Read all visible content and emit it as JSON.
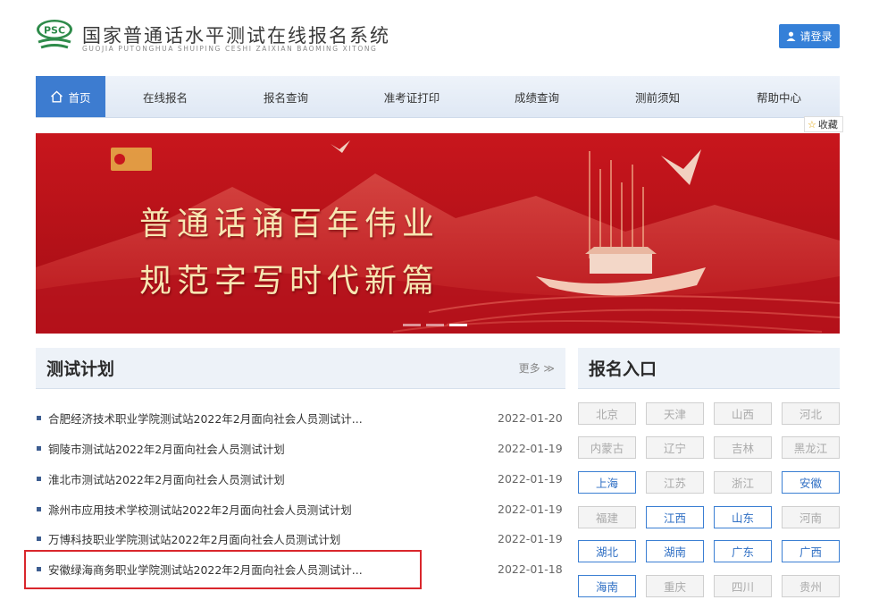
{
  "header": {
    "logo_text": "PSC",
    "title": "国家普通话水平测试在线报名系统",
    "subtitle": "GUOJIA PUTONGHUA SHUIPING CESHI ZAIXIAN BAOMING XITONG",
    "login_label": "请登录"
  },
  "nav": {
    "items": [
      "首页",
      "在线报名",
      "报名查询",
      "准考证打印",
      "成绩查询",
      "测前须知",
      "帮助中心"
    ],
    "favorite_label": "收藏"
  },
  "banner": {
    "line1": "普通话诵百年伟业",
    "line2": "规范字写时代新篇",
    "slides_total": 3,
    "slide_active": 3
  },
  "plan": {
    "title": "测试计划",
    "more_label": "更多 ≫",
    "rows": [
      {
        "text": "合肥经济技术职业学院测试站2022年2月面向社会人员测试计...",
        "date": "2022-01-20"
      },
      {
        "text": "铜陵市测试站2022年2月面向社会人员测试计划",
        "date": "2022-01-19"
      },
      {
        "text": "淮北市测试站2022年2月面向社会人员测试计划",
        "date": "2022-01-19"
      },
      {
        "text": "滁州市应用技术学校测试站2022年2月面向社会人员测试计划",
        "date": "2022-01-19"
      },
      {
        "text": "万博科技职业学院测试站2022年2月面向社会人员测试计划",
        "date": "2022-01-19"
      },
      {
        "text": "安徽绿海商务职业学院测试站2022年2月面向社会人员测试计...",
        "date": "2022-01-18"
      }
    ]
  },
  "signup": {
    "title": "报名入口",
    "regions": [
      {
        "name": "北京",
        "enabled": false
      },
      {
        "name": "天津",
        "enabled": false
      },
      {
        "name": "山西",
        "enabled": false
      },
      {
        "name": "河北",
        "enabled": false
      },
      {
        "name": "内蒙古",
        "enabled": false
      },
      {
        "name": "辽宁",
        "enabled": false
      },
      {
        "name": "吉林",
        "enabled": false
      },
      {
        "name": "黑龙江",
        "enabled": false
      },
      {
        "name": "上海",
        "enabled": true
      },
      {
        "name": "江苏",
        "enabled": false
      },
      {
        "name": "浙江",
        "enabled": false
      },
      {
        "name": "安徽",
        "enabled": true
      },
      {
        "name": "福建",
        "enabled": false
      },
      {
        "name": "江西",
        "enabled": true
      },
      {
        "name": "山东",
        "enabled": true
      },
      {
        "name": "河南",
        "enabled": false
      },
      {
        "name": "湖北",
        "enabled": true
      },
      {
        "name": "湖南",
        "enabled": true
      },
      {
        "name": "广东",
        "enabled": true
      },
      {
        "name": "广西",
        "enabled": true
      },
      {
        "name": "海南",
        "enabled": true
      },
      {
        "name": "重庆",
        "enabled": false
      },
      {
        "name": "四川",
        "enabled": false
      },
      {
        "name": "贵州",
        "enabled": false
      }
    ]
  },
  "colors": {
    "primary": "#3d7cd0",
    "banner_red": "#c8161d",
    "highlight_border": "#d9262c"
  }
}
